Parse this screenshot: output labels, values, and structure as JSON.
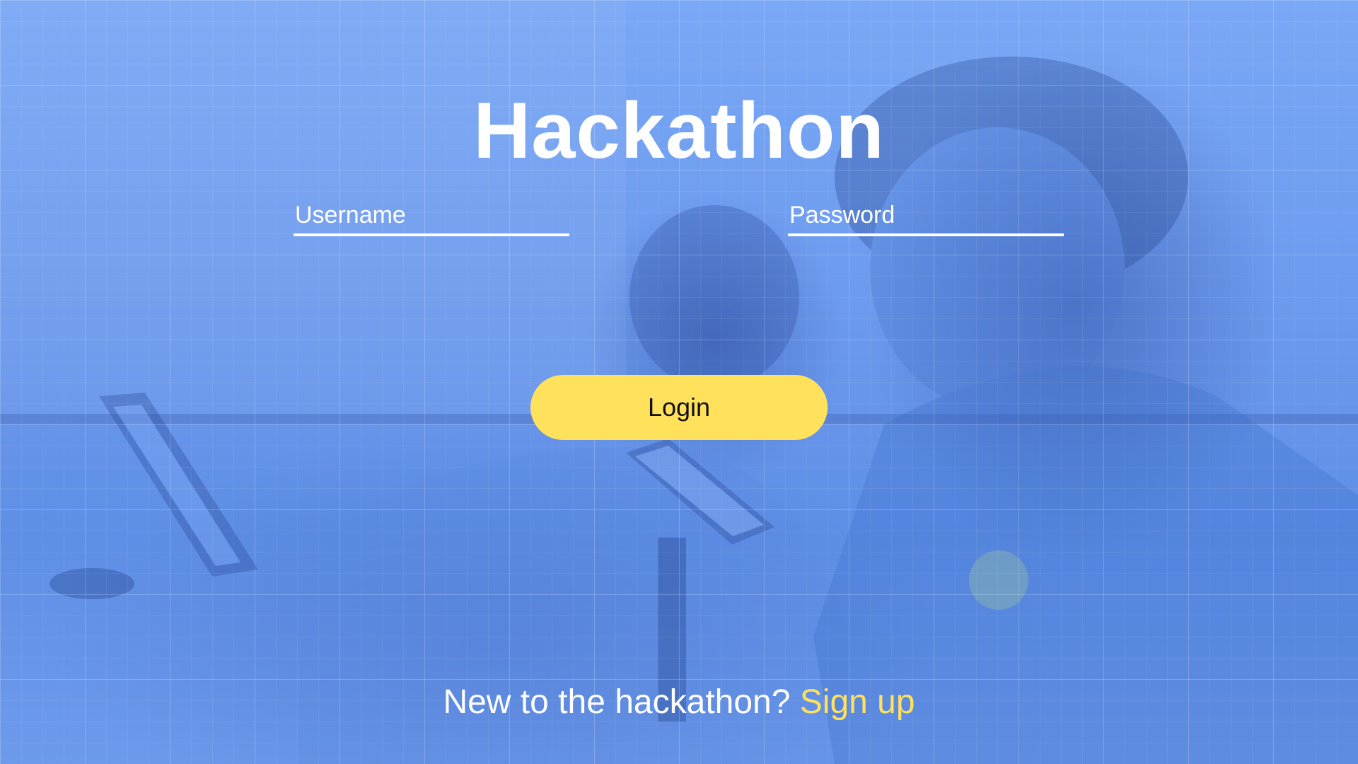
{
  "app": {
    "title": "Hackathon"
  },
  "form": {
    "username": {
      "placeholder": "Username",
      "value": ""
    },
    "password": {
      "placeholder": "Password",
      "value": ""
    },
    "login_label": "Login"
  },
  "footer": {
    "prompt": "New to the hackathon? ",
    "signup_label": "Sign up"
  },
  "colors": {
    "accent": "#ffe15c",
    "background": "#6f9ef0",
    "text": "#ffffff"
  }
}
